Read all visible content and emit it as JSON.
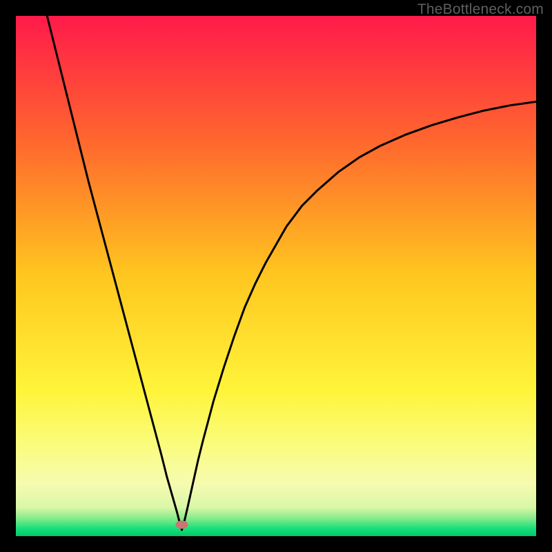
{
  "watermark": "TheBottleneck.com",
  "chart_data": {
    "type": "line",
    "title": "",
    "xlabel": "",
    "ylabel": "",
    "xlim": [
      0,
      100
    ],
    "ylim": [
      0,
      100
    ],
    "gradient_stops": [
      {
        "offset": 0,
        "color": "#ff1a4a"
      },
      {
        "offset": 0.25,
        "color": "#ff6a2d"
      },
      {
        "offset": 0.5,
        "color": "#ffc71f"
      },
      {
        "offset": 0.72,
        "color": "#fff43a"
      },
      {
        "offset": 0.82,
        "color": "#fafc7a"
      },
      {
        "offset": 0.9,
        "color": "#f6fbb0"
      },
      {
        "offset": 0.945,
        "color": "#d9f7a8"
      },
      {
        "offset": 0.965,
        "color": "#8beb8c"
      },
      {
        "offset": 0.985,
        "color": "#18df7a"
      },
      {
        "offset": 1.0,
        "color": "#05c76b"
      }
    ],
    "marker": {
      "x": 31.9,
      "y": 2.2,
      "color": "#cb7471"
    },
    "series": [
      {
        "name": "curve",
        "points": [
          {
            "x": 6.0,
            "y": 100.0
          },
          {
            "x": 8.0,
            "y": 92.0
          },
          {
            "x": 10.0,
            "y": 84.0
          },
          {
            "x": 12.0,
            "y": 76.0
          },
          {
            "x": 14.0,
            "y": 68.0
          },
          {
            "x": 16.0,
            "y": 60.5
          },
          {
            "x": 18.0,
            "y": 53.0
          },
          {
            "x": 20.0,
            "y": 45.5
          },
          {
            "x": 22.0,
            "y": 38.0
          },
          {
            "x": 24.0,
            "y": 30.5
          },
          {
            "x": 26.0,
            "y": 23.0
          },
          {
            "x": 28.0,
            "y": 15.5
          },
          {
            "x": 29.0,
            "y": 11.5
          },
          {
            "x": 30.0,
            "y": 8.0
          },
          {
            "x": 31.0,
            "y": 4.5
          },
          {
            "x": 31.5,
            "y": 2.5
          },
          {
            "x": 31.9,
            "y": 1.2
          },
          {
            "x": 32.3,
            "y": 2.5
          },
          {
            "x": 33.0,
            "y": 5.5
          },
          {
            "x": 34.0,
            "y": 10.0
          },
          {
            "x": 35.0,
            "y": 14.5
          },
          {
            "x": 36.0,
            "y": 18.5
          },
          {
            "x": 38.0,
            "y": 26.0
          },
          {
            "x": 40.0,
            "y": 32.5
          },
          {
            "x": 42.0,
            "y": 38.5
          },
          {
            "x": 44.0,
            "y": 44.0
          },
          {
            "x": 46.0,
            "y": 48.5
          },
          {
            "x": 48.0,
            "y": 52.5
          },
          {
            "x": 50.0,
            "y": 56.0
          },
          {
            "x": 52.0,
            "y": 59.5
          },
          {
            "x": 55.0,
            "y": 63.5
          },
          {
            "x": 58.0,
            "y": 66.5
          },
          {
            "x": 62.0,
            "y": 70.0
          },
          {
            "x": 66.0,
            "y": 72.8
          },
          {
            "x": 70.0,
            "y": 75.0
          },
          {
            "x": 75.0,
            "y": 77.2
          },
          {
            "x": 80.0,
            "y": 79.0
          },
          {
            "x": 85.0,
            "y": 80.5
          },
          {
            "x": 90.0,
            "y": 81.8
          },
          {
            "x": 95.0,
            "y": 82.8
          },
          {
            "x": 100.0,
            "y": 83.5
          }
        ]
      }
    ]
  }
}
